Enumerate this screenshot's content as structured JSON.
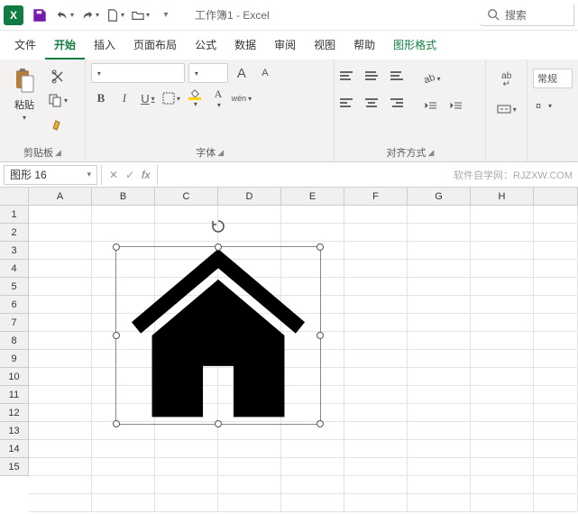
{
  "titlebar": {
    "app_badge": "X",
    "title": "工作簿1 - Excel",
    "search_placeholder": "搜索"
  },
  "tabs": {
    "items": [
      "文件",
      "开始",
      "插入",
      "页面布局",
      "公式",
      "数据",
      "审阅",
      "视图",
      "帮助",
      "图形格式"
    ],
    "active_index": 1,
    "contextual_index": 9
  },
  "ribbon": {
    "clipboard": {
      "paste": "粘贴",
      "group": "剪贴板"
    },
    "font": {
      "group": "字体",
      "bold": "B",
      "italic": "I",
      "underline": "U",
      "wen": "wén"
    },
    "increase_font": "A",
    "decrease_font": "A",
    "align": {
      "group": "对齐方式"
    },
    "wrap": "ab",
    "general": "常规"
  },
  "formula_bar": {
    "name": "图形 16",
    "fx": "fx",
    "hint": "软件自学网：RJZXW.COM"
  },
  "grid": {
    "cols": [
      "A",
      "B",
      "C",
      "D",
      "E",
      "F",
      "G",
      "H"
    ],
    "rows": [
      "1",
      "2",
      "3",
      "4",
      "5",
      "6",
      "7",
      "8",
      "9",
      "10",
      "11",
      "12",
      "13",
      "14",
      "15"
    ]
  },
  "shape": {
    "kind": "house-icon"
  }
}
